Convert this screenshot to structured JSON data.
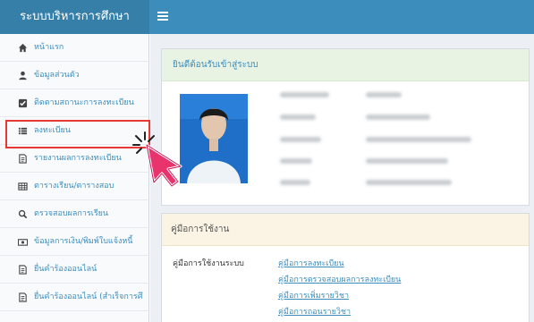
{
  "header": {
    "app_title": "ระบบบริหารการศึกษา",
    "menu_icon": "hamburger-icon"
  },
  "sidebar": {
    "items": [
      {
        "label": "หน้าแรก",
        "icon": "home-icon"
      },
      {
        "label": "ข้อมูลส่วนตัว",
        "icon": "user-icon"
      },
      {
        "label": "ติดตามสถานะการลงทะเบียน",
        "icon": "check-square-icon"
      },
      {
        "label": "ลงทะเบียน",
        "icon": "list-icon"
      },
      {
        "label": "รายงานผลการลงทะเบียน",
        "icon": "document-icon"
      },
      {
        "label": "ตารางเรียน/ตารางสอบ",
        "icon": "table-icon"
      },
      {
        "label": "ตรวจสอบผลการเรียน",
        "icon": "search-icon"
      },
      {
        "label": "ข้อมูลการเงิน/พิมพ์ใบแจ้งหนี้",
        "icon": "money-icon"
      },
      {
        "label": "ยื่นคำร้องออนไลน์",
        "icon": "document-icon"
      },
      {
        "label": "ยื่นคำร้องออนไลน์ (สำเร็จการศึ",
        "icon": "document-icon"
      }
    ]
  },
  "welcome": {
    "title": "ยินดีต้อนรับเข้าสู่ระบบ"
  },
  "manual": {
    "title": "คู่มือการใช้งาน",
    "label": "คู่มือการใช้งานระบบ",
    "links": [
      "คู่มือการลงทะเบียน",
      "คู่มือการตรวจสอบผลการลงทะเบียน",
      "คู่มือการเพิ่มรายวิชา",
      "คู่มือการถอนรายวิชา"
    ]
  },
  "colors": {
    "topbar": "#3c8dbc",
    "highlight": "#e53935",
    "cursor": "#e8336d"
  }
}
